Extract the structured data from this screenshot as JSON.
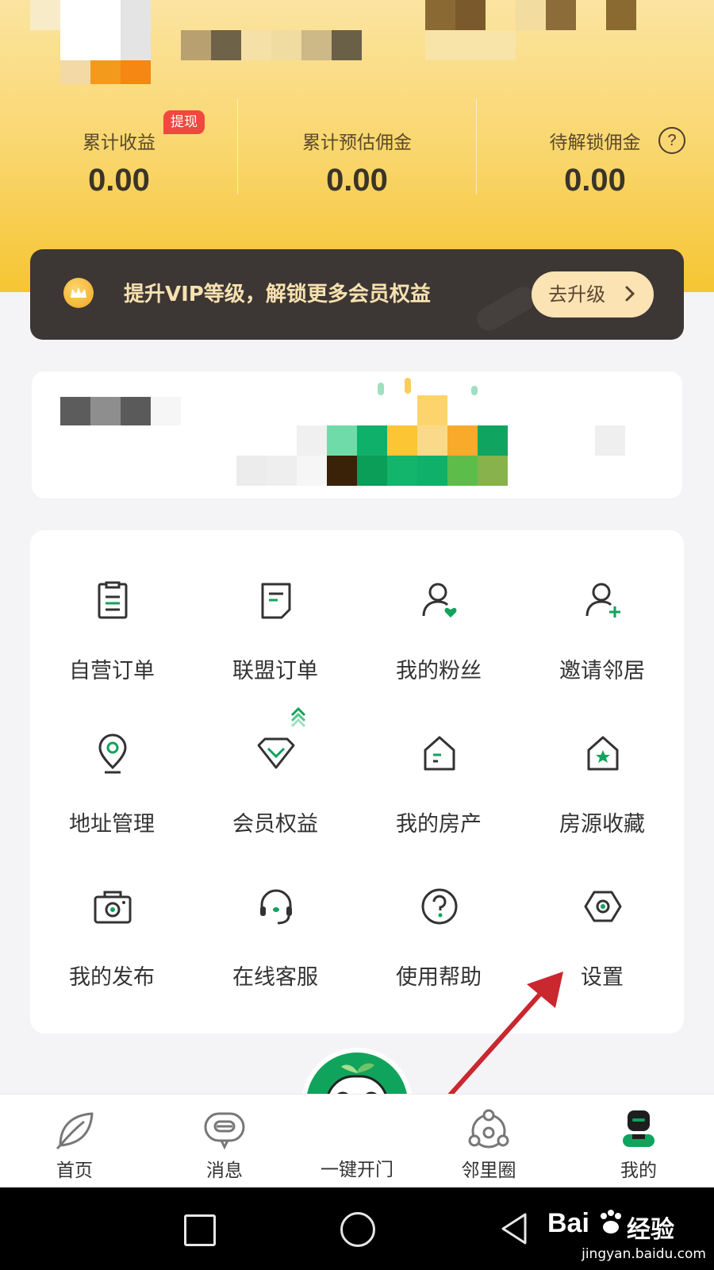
{
  "header": {
    "stats": [
      {
        "label": "累计收益",
        "value": "0.00",
        "badge": "提现"
      },
      {
        "label": "累计预估佣金",
        "value": "0.00"
      },
      {
        "label": "待解锁佣金",
        "value": "0.00"
      }
    ],
    "help_symbol": "?"
  },
  "vip_banner": {
    "text": "提升VIP等级，解锁更多会员权益",
    "button_label": "去升级",
    "button_icon": "chevron-right-icon"
  },
  "menu": {
    "items": [
      {
        "label": "自营订单",
        "icon": "self-order-icon"
      },
      {
        "label": "联盟订单",
        "icon": "alliance-order-icon"
      },
      {
        "label": "我的粉丝",
        "icon": "fans-icon"
      },
      {
        "label": "邀请邻居",
        "icon": "invite-neighbor-icon"
      },
      {
        "label": "地址管理",
        "icon": "location-icon"
      },
      {
        "label": "会员权益",
        "icon": "diamond-icon"
      },
      {
        "label": "我的房产",
        "icon": "house-icon"
      },
      {
        "label": "房源收藏",
        "icon": "house-star-icon"
      },
      {
        "label": "我的发布",
        "icon": "camera-icon"
      },
      {
        "label": "在线客服",
        "icon": "headset-icon"
      },
      {
        "label": "使用帮助",
        "icon": "help-icon"
      },
      {
        "label": "设置",
        "icon": "settings-hex-icon"
      }
    ]
  },
  "tabbar": {
    "tabs": [
      {
        "label": "首页",
        "icon": "leaf-icon"
      },
      {
        "label": "消息",
        "icon": "message-icon"
      },
      {
        "label": "一键开门",
        "icon": "mascot-icon"
      },
      {
        "label": "邻里圈",
        "icon": "neighborhood-icon"
      },
      {
        "label": "我的",
        "icon": "profile-icon"
      }
    ],
    "active_index": 4
  },
  "watermark": {
    "brand": "Bai",
    "brand_suffix": "经验",
    "url": "jingyan.baidu.com"
  },
  "colors": {
    "accent_green": "#10a35c",
    "header_yellow": "#f9d56a",
    "vip_dark": "#3c3634",
    "badge_red": "#f0483e",
    "annotation_red": "#c8282e"
  }
}
